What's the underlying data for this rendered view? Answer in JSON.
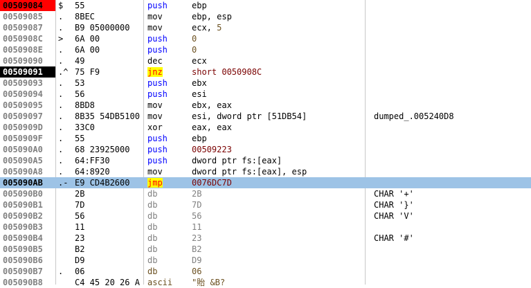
{
  "colors": {
    "eip_highlight": "#ff0000",
    "breakpoint_highlight": "#000000",
    "selected_row": "#9dc3e6",
    "jump_highlight": "#ffff00",
    "push_blue": "#0000ff",
    "db_gray": "#808080"
  },
  "rows": [
    {
      "addr": "00509084",
      "mark": "$",
      "hex": "55",
      "mnem": "push",
      "ops": "ebp",
      "comment": "",
      "addr_style": "eip",
      "mnem_style": "blue",
      "ops_style": "black"
    },
    {
      "addr": "00509085",
      "mark": ".",
      "hex": "8BEC",
      "mnem": "mov",
      "ops": "ebp, esp",
      "comment": "",
      "addr_style": "",
      "mnem_style": "black",
      "ops_style": "black"
    },
    {
      "addr": "00509087",
      "mark": ".",
      "hex": "B9 05000000",
      "mnem": "mov",
      "ops": "ecx, 5",
      "comment": "",
      "addr_style": "",
      "mnem_style": "black",
      "ops_style": "mixed5"
    },
    {
      "addr": "0050908C",
      "mark": ">",
      "hex": "6A 00",
      "mnem": "push",
      "ops": "0",
      "comment": "",
      "addr_style": "",
      "mnem_style": "blue",
      "ops_style": "num"
    },
    {
      "addr": "0050908E",
      "mark": ".",
      "hex": "6A 00",
      "mnem": "push",
      "ops": "0",
      "comment": "",
      "addr_style": "",
      "mnem_style": "blue",
      "ops_style": "num"
    },
    {
      "addr": "00509090",
      "mark": ".",
      "hex": "49",
      "mnem": "dec",
      "ops": "ecx",
      "comment": "",
      "addr_style": "",
      "mnem_style": "black",
      "ops_style": "black"
    },
    {
      "addr": "00509091",
      "mark": ".^",
      "hex": "75 F9",
      "mnem": "jnz",
      "ops": "short 0050908C",
      "comment": "",
      "addr_style": "bp",
      "mnem_style": "jump",
      "ops_style": "red"
    },
    {
      "addr": "00509093",
      "mark": ".",
      "hex": "53",
      "mnem": "push",
      "ops": "ebx",
      "comment": "",
      "addr_style": "",
      "mnem_style": "blue",
      "ops_style": "black"
    },
    {
      "addr": "00509094",
      "mark": ".",
      "hex": "56",
      "mnem": "push",
      "ops": "esi",
      "comment": "",
      "addr_style": "",
      "mnem_style": "blue",
      "ops_style": "black"
    },
    {
      "addr": "00509095",
      "mark": ".",
      "hex": "8BD8",
      "mnem": "mov",
      "ops": "ebx, eax",
      "comment": "",
      "addr_style": "",
      "mnem_style": "black",
      "ops_style": "black"
    },
    {
      "addr": "00509097",
      "mark": ".",
      "hex": "8B35 54DB5100",
      "mnem": "mov",
      "ops": "esi, dword ptr [51DB54]",
      "comment": "dumped_.005240D8",
      "addr_style": "",
      "mnem_style": "black",
      "ops_style": "black"
    },
    {
      "addr": "0050909D",
      "mark": ".",
      "hex": "33C0",
      "mnem": "xor",
      "ops": "eax, eax",
      "comment": "",
      "addr_style": "",
      "mnem_style": "black",
      "ops_style": "black"
    },
    {
      "addr": "0050909F",
      "mark": ".",
      "hex": "55",
      "mnem": "push",
      "ops": "ebp",
      "comment": "",
      "addr_style": "",
      "mnem_style": "blue",
      "ops_style": "black"
    },
    {
      "addr": "005090A0",
      "mark": ".",
      "hex": "68 23925000",
      "mnem": "push",
      "ops": "00509223",
      "comment": "",
      "addr_style": "",
      "mnem_style": "blue",
      "ops_style": "red"
    },
    {
      "addr": "005090A5",
      "mark": ".",
      "hex": "64:FF30",
      "mnem": "push",
      "ops": "dword ptr fs:[eax]",
      "comment": "",
      "addr_style": "",
      "mnem_style": "blue",
      "ops_style": "blue"
    },
    {
      "addr": "005090A8",
      "mark": ".",
      "hex": "64:8920",
      "mnem": "mov",
      "ops": "dword ptr fs:[eax], esp",
      "comment": "",
      "addr_style": "",
      "mnem_style": "black",
      "ops_style": "blue"
    },
    {
      "addr": "005090AB",
      "mark": ".-",
      "hex": "E9 CD4B2600",
      "mnem": "jmp",
      "ops": "0076DC7D",
      "comment": "",
      "addr_style": "sel",
      "mnem_style": "jump",
      "ops_style": "red"
    },
    {
      "addr": "005090B0",
      "mark": "",
      "hex": "2B",
      "mnem": "db",
      "ops": "2B",
      "comment": "CHAR '+'",
      "addr_style": "",
      "mnem_style": "gray",
      "ops_style": "gray"
    },
    {
      "addr": "005090B1",
      "mark": "",
      "hex": "7D",
      "mnem": "db",
      "ops": "7D",
      "comment": "CHAR '}'",
      "addr_style": "",
      "mnem_style": "gray",
      "ops_style": "gray"
    },
    {
      "addr": "005090B2",
      "mark": "",
      "hex": "56",
      "mnem": "db",
      "ops": "56",
      "comment": "CHAR 'V'",
      "addr_style": "",
      "mnem_style": "gray",
      "ops_style": "gray"
    },
    {
      "addr": "005090B3",
      "mark": "",
      "hex": "11",
      "mnem": "db",
      "ops": "11",
      "comment": "",
      "addr_style": "",
      "mnem_style": "gray",
      "ops_style": "gray"
    },
    {
      "addr": "005090B4",
      "mark": "",
      "hex": "23",
      "mnem": "db",
      "ops": "23",
      "comment": "CHAR '#'",
      "addr_style": "",
      "mnem_style": "gray",
      "ops_style": "gray"
    },
    {
      "addr": "005090B5",
      "mark": "",
      "hex": "B2",
      "mnem": "db",
      "ops": "B2",
      "comment": "",
      "addr_style": "",
      "mnem_style": "gray",
      "ops_style": "gray"
    },
    {
      "addr": "005090B6",
      "mark": "",
      "hex": "D9",
      "mnem": "db",
      "ops": "D9",
      "comment": "",
      "addr_style": "",
      "mnem_style": "gray",
      "ops_style": "gray"
    },
    {
      "addr": "005090B7",
      "mark": ".",
      "hex": "06",
      "mnem": "db",
      "ops": "06",
      "comment": "",
      "addr_style": "",
      "mnem_style": "brown",
      "ops_style": "num"
    },
    {
      "addr": "005090B8",
      "mark": "",
      "hex": "C4 45 20 26 A",
      "mnem": "ascii",
      "ops": "\"貽 &B?",
      "comment": "",
      "addr_style": "",
      "mnem_style": "brown",
      "ops_style": "num"
    }
  ]
}
